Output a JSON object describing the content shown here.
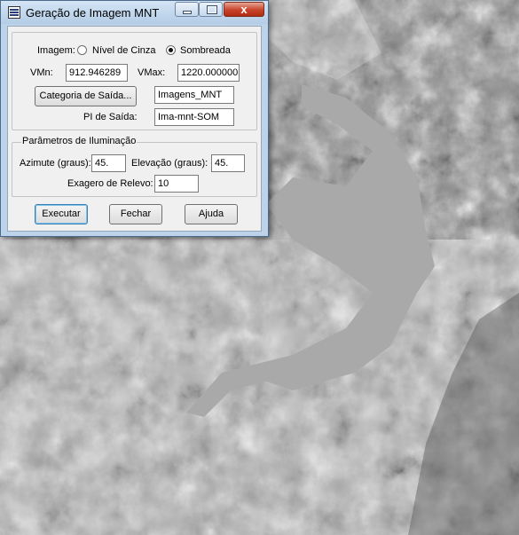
{
  "window": {
    "title": "Geração de Imagem MNT",
    "close_glyph": "x",
    "icons": [
      "app-icon",
      "minimize-icon",
      "maximize-icon",
      "close-icon"
    ]
  },
  "form": {
    "image_label": "Imagem:",
    "image_options": [
      {
        "label": "Nível de Cinza",
        "selected": false
      },
      {
        "label": "Sombreada",
        "selected": true
      }
    ],
    "vmin_label": "VMn:",
    "vmin_value": "912.946289",
    "vmax_label": "VMax:",
    "vmax_value": "1220.000000",
    "category_button": "Categoria de Saída...",
    "category_value": "Imagens_MNT",
    "pi_label": "PI de Saída:",
    "pi_value": "Ima-mnt-SOM"
  },
  "lighting": {
    "caption": "Parâmetros de Iluminação",
    "azimuth_label": "Azimute (graus):",
    "azimuth_value": "45.",
    "elevation_label": "Elevação (graus):",
    "elevation_value": "45.",
    "exaggeration_label": "Exagero de Relevo:",
    "exaggeration_value": "10"
  },
  "buttons": {
    "execute": "Executar",
    "close": "Fechar",
    "help": "Ajuda"
  },
  "colors": {
    "titlebar": "#bcd3ea",
    "dialog": "#f0f0f0",
    "close_button": "#c7432a",
    "default_button_border": "#3c7fb1",
    "terrain_base": "#8a8a8a"
  }
}
